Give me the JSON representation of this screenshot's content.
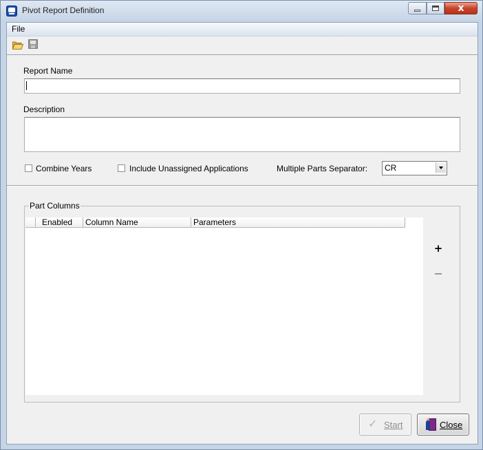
{
  "window": {
    "title": "Pivot Report Definition",
    "close_glyph": "x"
  },
  "menu": {
    "file": "File"
  },
  "toolbar": {
    "icons": [
      "open-folder-icon",
      "save-disk-icon"
    ]
  },
  "form": {
    "report_name_label": "Report Name",
    "report_name_value": "",
    "description_label": "Description",
    "description_value": "",
    "combine_years_label": "Combine Years",
    "combine_years_checked": false,
    "include_unassigned_label": "Include Unassigned Applications",
    "include_unassigned_checked": false,
    "separator_label": "Multiple Parts Separator:",
    "separator_value": "CR"
  },
  "part_columns": {
    "title": "Part Columns",
    "columns": [
      "Enabled",
      "Column Name",
      "Parameters"
    ],
    "rows": [],
    "add_glyph": "+"
  },
  "buttons": {
    "start": "Start",
    "start_enabled": false,
    "close": "Close"
  },
  "colors": {
    "title_bar": "#c5d4e6",
    "client_bg": "#f0f0f0",
    "close_button": "#c8432a"
  }
}
